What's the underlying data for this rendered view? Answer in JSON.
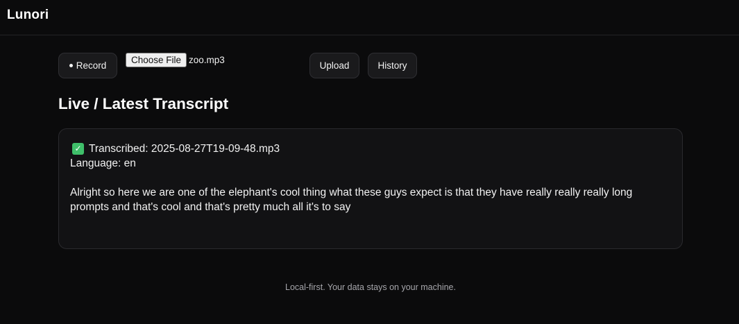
{
  "app": {
    "title": "Lunori"
  },
  "toolbar": {
    "record_label": "Record",
    "choose_file_label": "Choose File",
    "file_name": "zoo.mp3",
    "upload_label": "Upload",
    "history_label": "History"
  },
  "main": {
    "section_title": "Live / Latest Transcript",
    "transcript": {
      "status_label": "Transcribed: 2025-08-27T19-09-48.mp3",
      "language_label": "Language: en",
      "text": "Alright so here we are one of the elephant's cool thing what these guys expect is that they have really really really long prompts and that's cool and that's pretty much all it's to say"
    }
  },
  "footer": {
    "text": "Local-first. Your data stays on your machine."
  },
  "icons": {
    "status": "check-mark-icon",
    "record": "record-dot-icon"
  },
  "colors": {
    "background": "#0b0b0c",
    "card": "#121214",
    "success": "#3fbf6a"
  }
}
